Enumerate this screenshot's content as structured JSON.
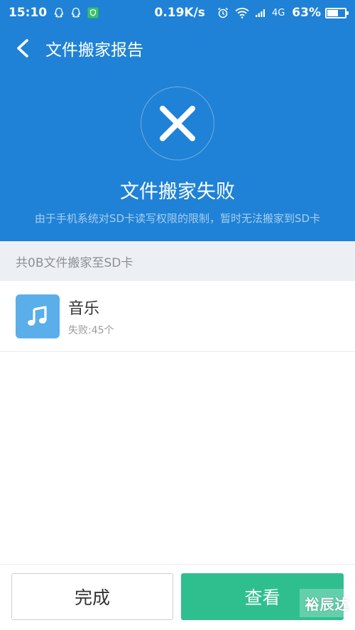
{
  "status_bar": {
    "time": "15:10",
    "speed": "0.19K/s",
    "network": "4G",
    "battery_percent": "63%",
    "battery_level": 0.63,
    "left_icons": [
      "qq-icon",
      "qq-icon",
      "shield-app-icon"
    ],
    "right_icons": [
      "alarm-icon",
      "wifi-icon",
      "signal-icon"
    ]
  },
  "toolbar": {
    "title": "文件搬家报告"
  },
  "result": {
    "icon": "close-icon",
    "title": "文件搬家失败",
    "description": "由于手机系统对SD卡读写权限的限制，暂时无法搬家到SD卡"
  },
  "summary": {
    "text": "共0B文件搬家至SD卡"
  },
  "list": {
    "items": [
      {
        "icon": "music-note-icon",
        "name": "音乐",
        "status": "失败:45个"
      }
    ]
  },
  "bottom": {
    "done_label": "完成",
    "view_label": "查看"
  },
  "watermark": "裕辰达",
  "colors": {
    "primary_blue": "#1f82d6",
    "primary_green": "#2fbf8f",
    "music_tile": "#5aaee9"
  }
}
